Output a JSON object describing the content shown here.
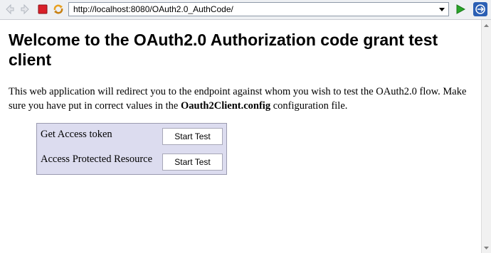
{
  "browser": {
    "url": "http://localhost:8080/OAuth2.0_AuthCode/",
    "icons": [
      "back-icon",
      "forward-icon",
      "stop-icon",
      "refresh-icon",
      "dropdown-icon",
      "go-icon",
      "app-logo-icon"
    ],
    "colors": {
      "stop": "#d9202a",
      "go": "#2aa52a",
      "refresh": "#e8a020",
      "logo": "#2b5fb4"
    }
  },
  "page": {
    "heading": "Welcome to the OAuth2.0 Authorization code grant test client",
    "intro_before": "This web application will redirect you to the endpoint against whom you wish to test the OAuth2.0 flow. Make sure you have put in correct values in the ",
    "intro_bold": "Oauth2Client.config",
    "intro_after": " configuration file.",
    "tests": [
      {
        "label": "Get Access token",
        "button": "Start Test"
      },
      {
        "label": "Access Protected Resource",
        "button": "Start Test"
      }
    ],
    "panel_color": "#dcdcef"
  }
}
